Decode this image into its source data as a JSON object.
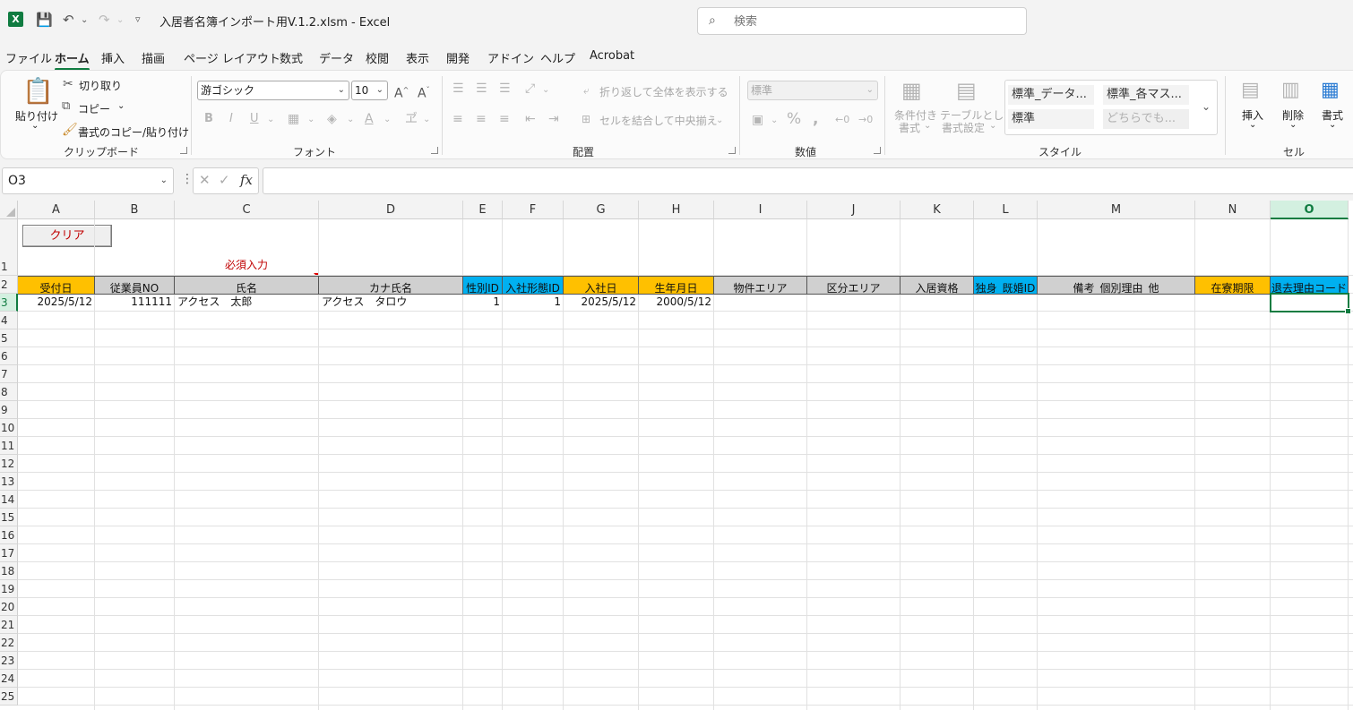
{
  "title_bar": {
    "title": "入居者名簿インポート用V.1.2.xlsm  -  Excel",
    "app_logo": "X",
    "search_placeholder": "検索"
  },
  "menu_tabs": [
    "ファイル",
    "ホーム",
    "挿入",
    "描画",
    "ページ レイアウト",
    "数式",
    "データ",
    "校閲",
    "表示",
    "開発",
    "アドイン",
    "ヘルプ",
    "Acrobat"
  ],
  "active_tab": "ホーム",
  "ribbon": {
    "clipboard": {
      "paste": "貼り付け",
      "cut": "切り取り",
      "copy": "コピー",
      "format_painter": "書式のコピー/貼り付け",
      "label": "クリップボード"
    },
    "font": {
      "font_name": "游ゴシック",
      "font_size": "10",
      "label": "フォント",
      "bold": "B",
      "italic": "I",
      "underline": "U"
    },
    "alignment": {
      "wrap": "折り返して全体を表示する",
      "merge": "セルを結合して中央揃え",
      "label": "配置"
    },
    "number": {
      "format": "標準",
      "label": "数値"
    },
    "styles": {
      "conditional": [
        "条件付き",
        "書式"
      ],
      "table": [
        "テーブルとして",
        "書式設定"
      ],
      "cells": [
        "標準_データ...",
        "標準_各マス...",
        "標準",
        "どちらでも..."
      ],
      "label": "スタイル"
    },
    "cells": {
      "insert": "挿入",
      "delete": "削除",
      "format": "書式",
      "label": "セル"
    }
  },
  "formula_bar": {
    "name_box": "O3",
    "fx": "fx",
    "formula": ""
  },
  "columns": [
    "A",
    "B",
    "C",
    "D",
    "E",
    "F",
    "G",
    "H",
    "I",
    "J",
    "K",
    "L",
    "M",
    "N",
    "O"
  ],
  "selected_column": "O",
  "rows": [
    "1",
    "2",
    "3",
    "4",
    "5",
    "6",
    "7",
    "8",
    "9",
    "10",
    "11",
    "12",
    "13",
    "14",
    "15",
    "16",
    "17",
    "18",
    "19",
    "20",
    "21",
    "22",
    "23",
    "24",
    "25"
  ],
  "selected_row": "3",
  "sheet": {
    "clear_button": "クリア",
    "required_note": "必須入力",
    "headers": [
      "受付日",
      "従業員NO",
      "氏名",
      "カナ氏名",
      "性別ID",
      "入社形態ID",
      "入社日",
      "生年月日",
      "物件エリア",
      "区分エリア",
      "入居資格",
      "独身_既婚ID",
      "備考_個別理由_他",
      "在寮期限",
      "退去理由コード"
    ],
    "header_colors": [
      "orange",
      "grey",
      "grey",
      "grey",
      "blue",
      "blue",
      "orange",
      "orange",
      "grey",
      "grey",
      "grey",
      "blue",
      "grey",
      "orange",
      "blue"
    ],
    "row3": [
      "2025/5/12",
      "111111",
      "アクセス　太郎",
      "アクセス　タロウ",
      "1",
      "1",
      "2025/5/12",
      "2000/5/12",
      "",
      "",
      "",
      "",
      "",
      "",
      ""
    ]
  },
  "colors": {
    "excel_green": "#107c41",
    "orange": "#ffc000",
    "blue": "#00b0f0",
    "grey": "#d0d0d0",
    "required_red": "#c00000"
  }
}
